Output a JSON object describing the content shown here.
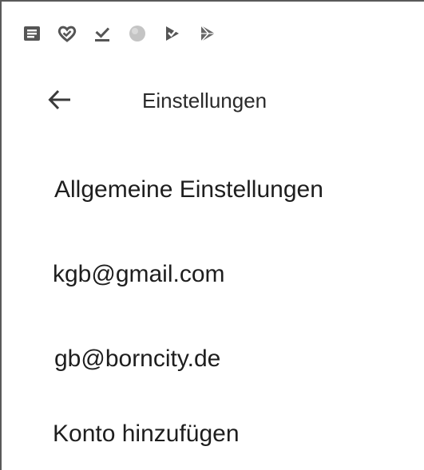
{
  "status_bar": {
    "icons": [
      "notes-icon",
      "heart-check-icon",
      "download-icon",
      "circle-icon",
      "play-check-icon",
      "play-store-icon"
    ]
  },
  "toolbar": {
    "back_icon": "arrow-left-icon",
    "title": "Einstellungen"
  },
  "settings": {
    "items": [
      {
        "label": "Allgemeine Einstellungen"
      },
      {
        "label": "kgb@gmail.com"
      },
      {
        "label": "gb@borncity.de"
      },
      {
        "label": "Konto hinzufügen"
      }
    ]
  },
  "colors": {
    "background": "#ffffff",
    "text": "#1e1e1e",
    "icon": "#555555"
  }
}
